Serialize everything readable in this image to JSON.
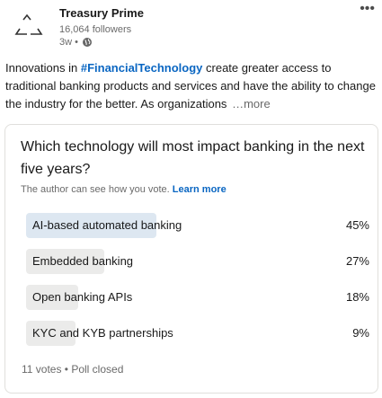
{
  "post": {
    "company_name": "Treasury Prime",
    "followers": "16,064 followers",
    "time_ago": "3w •",
    "more_menu": "•••",
    "text_before": "Innovations in ",
    "hashtag": "#FinancialTechnology",
    "text_after": " create greater access to traditional banking products and services and have the ability to change the industry for the better. As organizations",
    "see_more": "…more"
  },
  "poll": {
    "question": "Which technology will most impact banking in the next five years?",
    "note": "The author can see how you vote. ",
    "learn_more": "Learn more",
    "options": [
      {
        "label": "AI-based automated banking",
        "percent": "45%",
        "fraction": 0.45,
        "color": "#dde7f1"
      },
      {
        "label": "Embedded banking",
        "percent": "27%",
        "fraction": 0.27,
        "color": "#ebebea"
      },
      {
        "label": "Open banking APIs",
        "percent": "18%",
        "fraction": 0.18,
        "color": "#ebebea"
      },
      {
        "label": "KYC and KYB partnerships",
        "percent": "9%",
        "fraction": 0.09,
        "color": "#ebebea"
      }
    ],
    "footer": "11 votes • Poll closed"
  },
  "icons": {
    "logo": "treasury-prime-logo",
    "visibility": "globe-icon",
    "menu": "more-options-icon"
  }
}
